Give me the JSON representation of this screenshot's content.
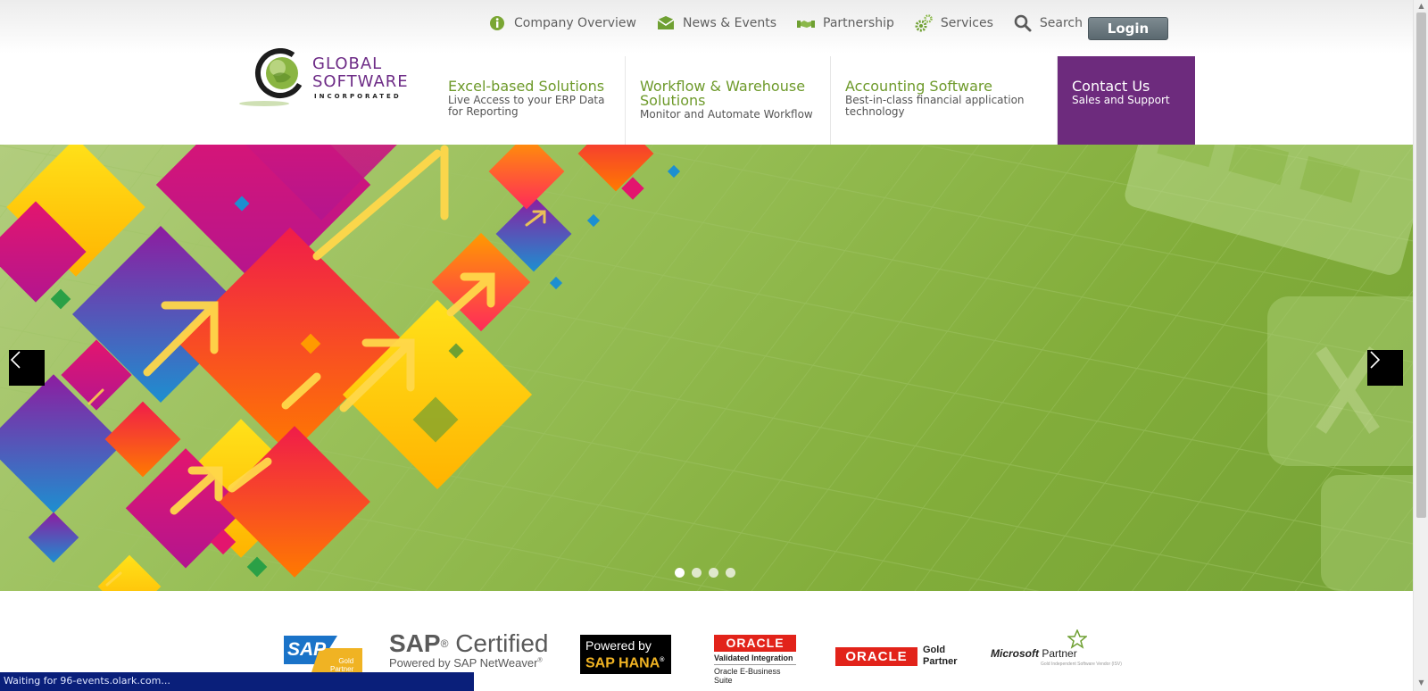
{
  "utility_nav": [
    {
      "label": "Company Overview",
      "icon": "info-icon"
    },
    {
      "label": "News & Events",
      "icon": "envelope-icon"
    },
    {
      "label": "Partnership",
      "icon": "handshake-icon"
    },
    {
      "label": "Services",
      "icon": "gears-icon"
    },
    {
      "label": "Search",
      "icon": "search-icon"
    }
  ],
  "login_label": "Login",
  "logo": {
    "line1": "GLOBAL",
    "line2": "SOFTWARE",
    "line3": "INCORPORATED"
  },
  "main_nav": [
    {
      "title": "Excel-based Solutions",
      "sub": "Live Access to your ERP Data for Reporting"
    },
    {
      "title": "Workflow & Warehouse Solutions",
      "sub": "Monitor and Automate Workflow"
    },
    {
      "title": "Accounting Software",
      "sub": "Best-in-class financial application technology"
    },
    {
      "title": "Contact Us",
      "sub": "Sales and Support"
    }
  ],
  "carousel": {
    "slide_count": 4,
    "active_index": 0
  },
  "partners": {
    "sap_gold": {
      "logo": "SAP",
      "badge_line1": "Gold",
      "badge_line2": "Partner"
    },
    "sap_certified": {
      "title": "SAP",
      "title_reg": "®",
      "title2": "Certified",
      "sub": "Powered by SAP NetWeaver",
      "sub_reg": "®"
    },
    "sap_hana": {
      "line1": "Powered by",
      "line2": "SAP HANA",
      "reg": "®"
    },
    "oracle_validated": {
      "logo": "ORACLE",
      "line1": "Validated Integration",
      "line2": "Oracle E-Business",
      "line3": "Suite"
    },
    "oracle_gold": {
      "logo": "ORACLE",
      "line1": "Gold",
      "line2": "Partner"
    },
    "microsoft_partner": {
      "logo": "Microsoft",
      "partner": "Partner",
      "sub": "Gold Independent Software Vendor (ISV)"
    }
  },
  "status_text": "Waiting for 96-events.olark.com...",
  "colors": {
    "brand_purple": "#6d2b7d",
    "nav_green": "#6e9a2b",
    "hero_green": "#8fb84b"
  }
}
